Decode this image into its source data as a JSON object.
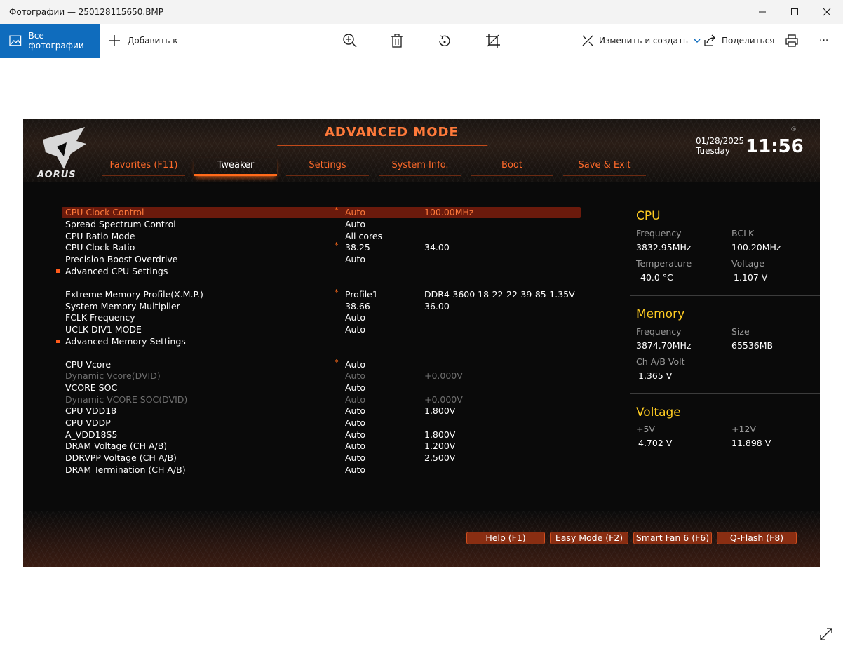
{
  "window": {
    "title": "Фотографии — 250128115650.BMP"
  },
  "toolbar": {
    "all_photos": "Все фотографии",
    "add_to": "Добавить к",
    "edit_create": "Изменить и создать",
    "share": "Поделиться",
    "more": "···"
  },
  "bios": {
    "mode_title": "ADVANCED MODE",
    "logo": "AORUS",
    "tabs": [
      "Favorites (F11)",
      "Tweaker",
      "Settings",
      "System Info.",
      "Boot",
      "Save & Exit"
    ],
    "active_tab": "Tweaker",
    "date": "01/28/2025",
    "day": "Tuesday",
    "time": "11:56",
    "settings": [
      {
        "label": "CPU Clock Control",
        "value": "Auto",
        "value2": "100.00MHz",
        "star": "*",
        "selected": true
      },
      {
        "label": "Spread Spectrum Control",
        "value": "Auto",
        "value2": ""
      },
      {
        "label": "CPU Ratio Mode",
        "value": "All cores",
        "value2": ""
      },
      {
        "label": "CPU Clock Ratio",
        "value": "38.25",
        "value2": "34.00",
        "star": "*"
      },
      {
        "label": "Precision Boost Overdrive",
        "value": "Auto",
        "value2": ""
      },
      {
        "label": "Advanced CPU Settings",
        "value": "",
        "value2": "",
        "submenu": true
      },
      {
        "label": "Extreme Memory Profile(X.M.P.)",
        "value": "Profile1",
        "value2": "DDR4-3600 18-22-22-39-85-1.35V",
        "star": "*"
      },
      {
        "label": "System Memory Multiplier",
        "value": "38.66",
        "value2": "36.00"
      },
      {
        "label": "FCLK Frequency",
        "value": "Auto",
        "value2": ""
      },
      {
        "label": "UCLK DIV1 MODE",
        "value": "Auto",
        "value2": ""
      },
      {
        "label": "Advanced Memory Settings",
        "value": "",
        "value2": "",
        "submenu": true
      },
      {
        "label": "CPU Vcore",
        "value": "Auto",
        "value2": "",
        "star": "*"
      },
      {
        "label": "Dynamic Vcore(DVID)",
        "value": "Auto",
        "value2": "+0.000V",
        "dim": true
      },
      {
        "label": "VCORE SOC",
        "value": "Auto",
        "value2": ""
      },
      {
        "label": "Dynamic VCORE SOC(DVID)",
        "value": "Auto",
        "value2": "+0.000V",
        "dim": true
      },
      {
        "label": "CPU VDD18",
        "value": "Auto",
        "value2": "1.800V"
      },
      {
        "label": "CPU VDDP",
        "value": "Auto",
        "value2": ""
      },
      {
        "label": "A_VDD18S5",
        "value": "Auto",
        "value2": "1.800V"
      },
      {
        "label": "DRAM Voltage     (CH A/B)",
        "value": "Auto",
        "value2": "1.200V"
      },
      {
        "label": "DDRVPP Voltage     (CH A/B)",
        "value": "Auto",
        "value2": "2.500V"
      },
      {
        "label": "DRAM Termination  (CH A/B)",
        "value": "Auto",
        "value2": ""
      }
    ],
    "panel": {
      "cpu": {
        "title": "CPU",
        "freq_label": "Frequency",
        "freq": "3832.95MHz",
        "bclk_label": "BCLK",
        "bclk": "100.20MHz",
        "temp_label": "Temperature",
        "temp": "40.0 °C",
        "volt_label": "Voltage",
        "volt": "1.107 V"
      },
      "memory": {
        "title": "Memory",
        "freq_label": "Frequency",
        "freq": "3874.70MHz",
        "size_label": "Size",
        "size": "65536MB",
        "chab_label": "Ch A/B Volt",
        "chab": "1.365 V"
      },
      "voltage": {
        "title": "Voltage",
        "p5_label": "+5V",
        "p5": "4.702 V",
        "p12_label": "+12V",
        "p12": "11.898 V"
      }
    },
    "footer_buttons": [
      "Help (F1)",
      "Easy Mode (F2)",
      "Smart Fan 6 (F6)",
      "Q-Flash (F8)"
    ]
  }
}
